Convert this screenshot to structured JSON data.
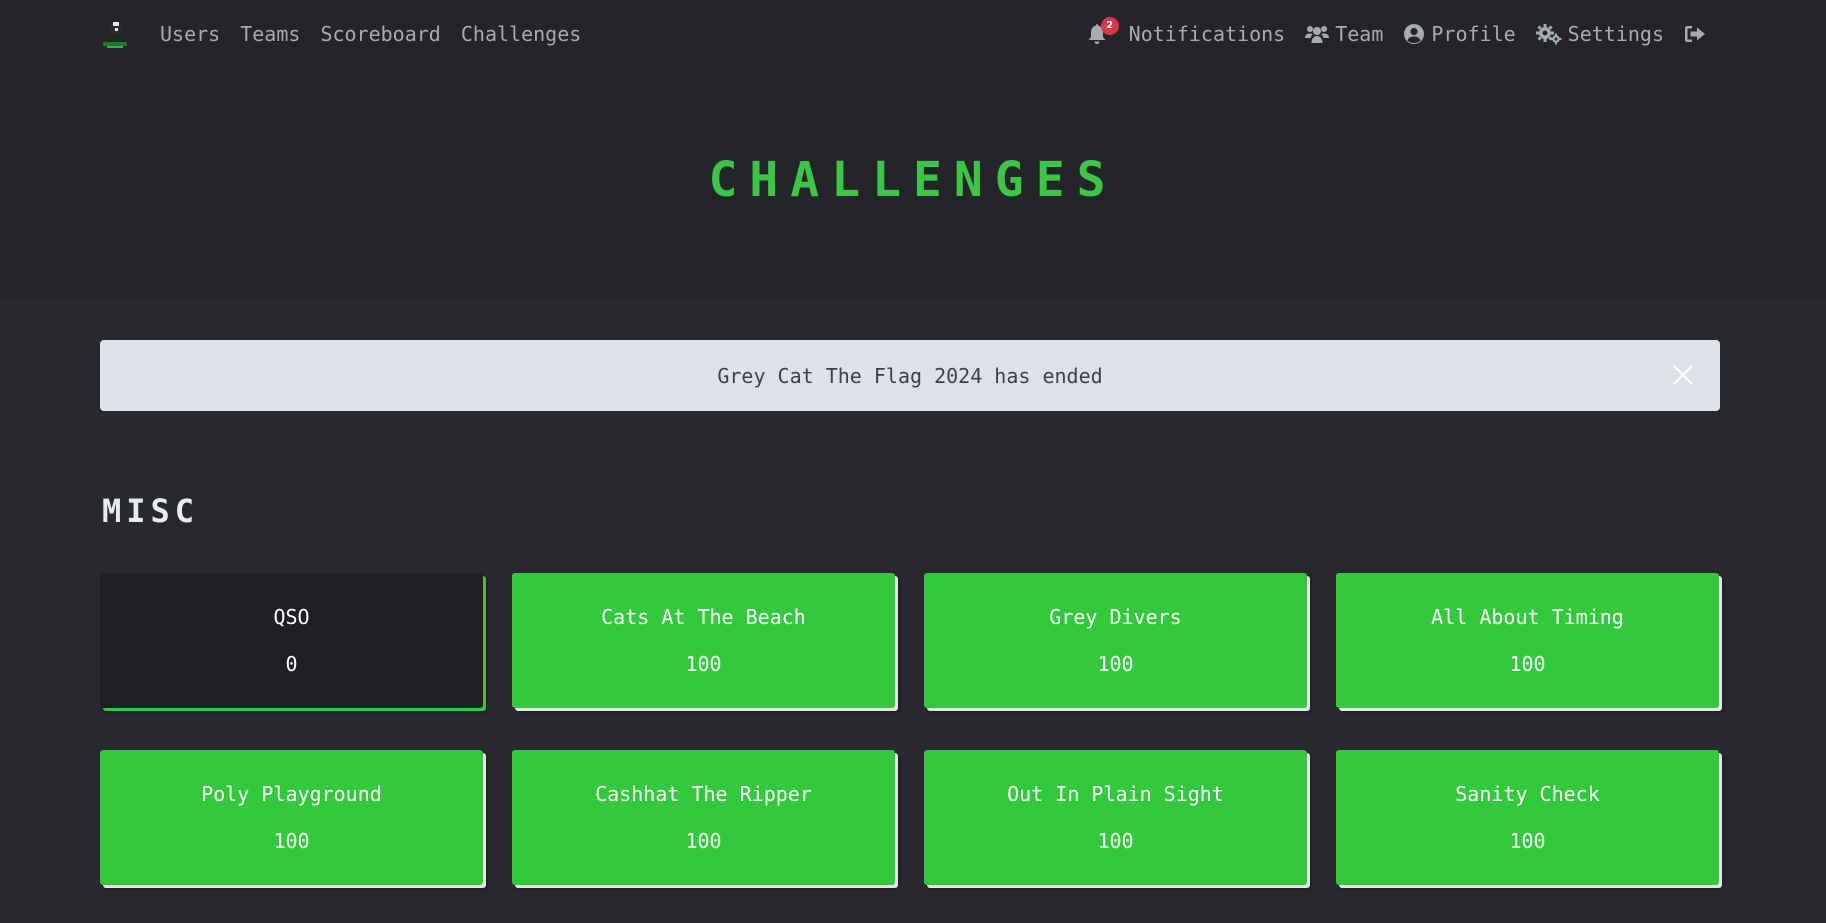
{
  "nav": {
    "left_links": [
      "Users",
      "Teams",
      "Scoreboard",
      "Challenges"
    ],
    "notifications_label": "Notifications",
    "notifications_count": "2",
    "team_label": "Team",
    "profile_label": "Profile",
    "settings_label": "Settings",
    "icons": [
      "bell-icon",
      "users-icon",
      "user-circle-icon",
      "cogs-icon",
      "logout-icon"
    ]
  },
  "page": {
    "title": "CHALLENGES"
  },
  "alert": {
    "message": "Grey Cat The Flag 2024 has ended"
  },
  "categories": [
    {
      "name": "MISC",
      "challenges": [
        {
          "name": "QSO",
          "value": "0",
          "solved": false
        },
        {
          "name": "Cats At The Beach",
          "value": "100",
          "solved": true
        },
        {
          "name": "Grey Divers",
          "value": "100",
          "solved": true
        },
        {
          "name": "All About Timing",
          "value": "100",
          "solved": true
        },
        {
          "name": "Poly Playground",
          "value": "100",
          "solved": true
        },
        {
          "name": "Cashhat The Ripper",
          "value": "100",
          "solved": true
        },
        {
          "name": "Out In Plain Sight",
          "value": "100",
          "solved": true
        },
        {
          "name": "Sanity Check",
          "value": "100",
          "solved": true
        }
      ]
    }
  ],
  "colors": {
    "accent": "#33c93c",
    "title_green": "#3ac746",
    "background": "#27292e",
    "header_bg": "#232529",
    "alert_bg": "#dee2e8",
    "badge_red": "#dc3545"
  }
}
